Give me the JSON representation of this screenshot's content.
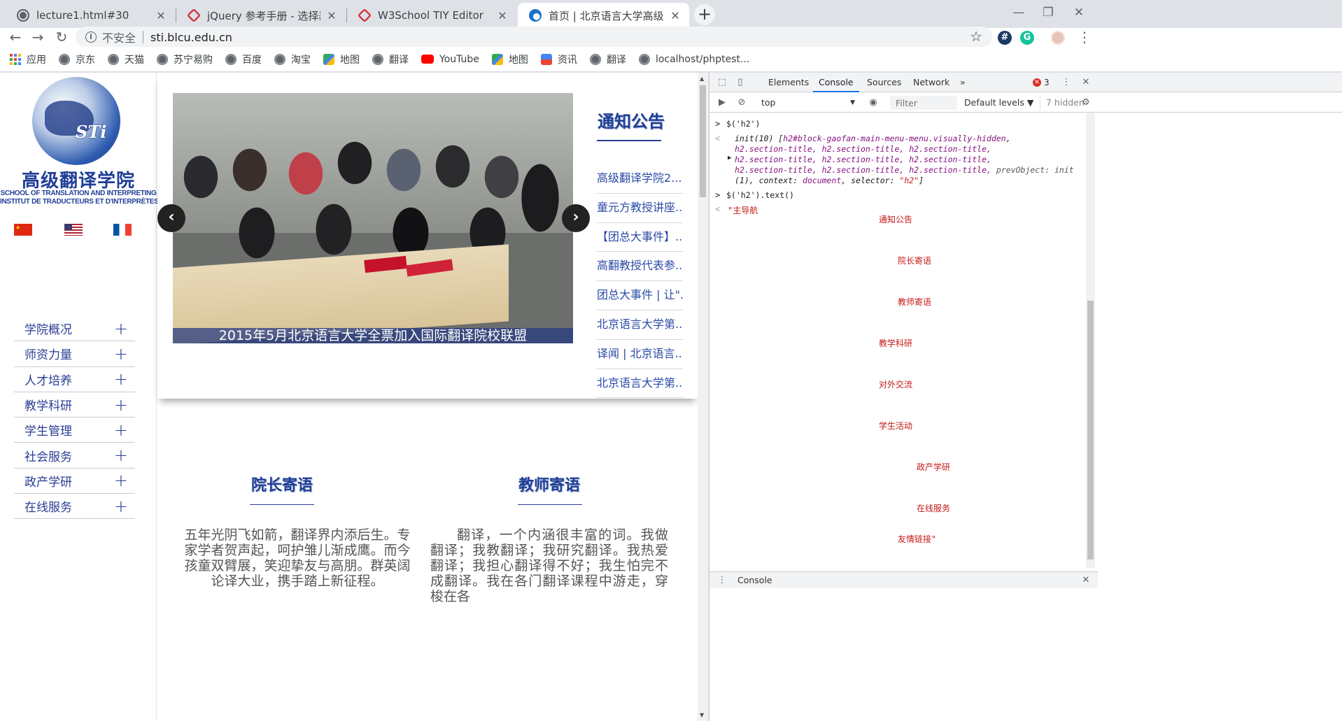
{
  "browser": {
    "tabs": [
      {
        "title": "lecture1.html#30",
        "icon": "globe-icon"
      },
      {
        "title": "jQuery 参考手册 - 选择器",
        "icon": "w3school-icon"
      },
      {
        "title": "W3School TIY Editor",
        "icon": "w3school-icon"
      },
      {
        "title": "首页 | 北京语言大学高级翻译学院",
        "icon": "edge-icon",
        "active": true
      }
    ],
    "tab_close": "✕",
    "new_tab": "+",
    "window_controls": [
      "—",
      "❐",
      "✕"
    ],
    "nav": {
      "back": "←",
      "forward": "→",
      "reload": "↻"
    },
    "address": {
      "info": "i",
      "security": "不安全",
      "url": "sti.blcu.edu.cn"
    },
    "star": "☆",
    "extensions": [
      "#",
      "G"
    ],
    "menu": "⋮",
    "bookmarks": [
      "应用",
      "京东",
      "天猫",
      "苏宁易购",
      "百度",
      "淘宝",
      "地图",
      "翻译",
      "YouTube",
      "地图",
      "资讯",
      "翻译",
      "localhost/phptest..."
    ]
  },
  "site": {
    "logo_mark": "STi",
    "logo_name": "高级翻译学院",
    "logo_en_1": "SCHOOL OF TRANSLATION AND INTERPRETING",
    "logo_en_2": "INSTITUT DE TRADUCTEURS ET D'INTERPRÈTES",
    "nav": [
      "学院概况",
      "师资力量",
      "人才培养",
      "教学科研",
      "学生管理",
      "社会服务",
      "政产学研",
      "在线服务"
    ],
    "nav_expand": "+",
    "slider": {
      "caption": "2015年5月北京语言大学全票加入国际翻译院校联盟",
      "prev": "‹",
      "next": "›"
    },
    "notice_title": "通知公告",
    "notices": [
      "高级翻译学院2...",
      "童元方教授讲座...",
      "【团总大事件】...",
      "高翻教授代表参...",
      "团总大事件 | 让\"...",
      "北京语言大学第...",
      "译闻 | 北京语言...",
      "北京语言大学第..."
    ],
    "dean_title": "院长寄语",
    "dean_text": "五年光阴飞如箭，翻译界内添后生。专家学者贺声起，呵护雏儿渐成鹰。而今孩童双臂展，笑迎挚友与高朋。群英阔论译大业，携手踏上新征程。",
    "teacher_title": "教师寄语",
    "teacher_text": "翻译，一个内涵很丰富的词。我做翻译；我教翻译；我研究翻译。我热爱翻译；我担心翻译得不好；我生怕完不成翻译。我在各门翻译课程中游走，穿梭在各"
  },
  "devtools": {
    "tabs": [
      "Elements",
      "Console",
      "Sources",
      "Network"
    ],
    "active_tab": "Console",
    "more_tabs": "»",
    "error_count": "3",
    "context": "top",
    "filter_placeholder": "Filter",
    "levels": "Default levels ▼",
    "hidden": "7 hidden",
    "drawer_tab": "Console",
    "console": {
      "cmd1": "$('h2')",
      "res1_l1a": "init(10) [",
      "res1_l1b": "h2#block-gaofan-main-menu-menu.visually-hidden",
      "res1_l2": "h2.section-title, h2.section-title, h2.section-title,",
      "res1_l3": "h2.section-title, h2.section-title, h2.section-title,",
      "res1_l4a": "h2.section-title, h2.section-title, h2.section-title,",
      "res1_l4b": "prevObject: init",
      "res1_l5a": "(1), context: ",
      "res1_l5b": "document",
      "res1_l5c": ", selector: ",
      "res1_l5d": "\"h2\"",
      "res1_l5e": "]",
      "cmd2": "$('h2').text()",
      "out": [
        "\"主导航",
        "通知公告",
        "院长寄语",
        "教师寄语",
        "教学科研",
        "对外交流",
        "学生活动",
        "政产学研",
        "在线服务",
        "友情链接\""
      ]
    }
  }
}
